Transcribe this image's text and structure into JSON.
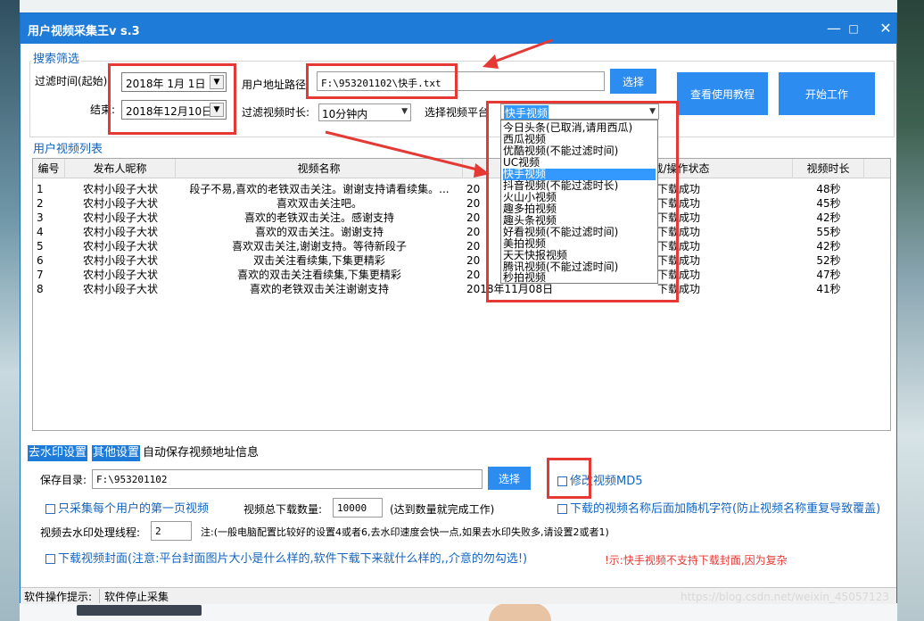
{
  "window": {
    "title": "用户视频采集王v s.3",
    "minimize_glyph": "—",
    "maximize_glyph": "□",
    "close_glyph": "✕"
  },
  "search": {
    "group_title": "搜索筛选",
    "start_label": "过滤时间(起始):",
    "start_date": "2018年 1月 1日",
    "end_label": "结束:",
    "end_date": "2018年12月10日",
    "path_label": "用户地址路径:",
    "path_value": "F:\\953201102\\快手.txt",
    "select_button": "选择",
    "duration_label": "过滤视频时长:",
    "duration_value": "10分钟内",
    "platform_label": "选择视频平台",
    "platform_value": "快手视频",
    "tutorial_button": "查看使用教程",
    "start_button": "开始工作"
  },
  "platform_options": [
    "今日头条(已取消,请用西瓜)",
    "西瓜视频",
    "优酷视频(不能过滤时间)",
    "UC视频",
    "快手视频",
    "抖音视频(不能过滤时长)",
    "火山小视频",
    "趣多拍视频",
    "趣头条视频",
    "好看视频(不能过滤时间)",
    "美拍视频",
    "天天快报视频",
    "腾讯视频(不能过滤时间)",
    "秒拍视频"
  ],
  "video_list": {
    "group_title": "用户视频列表",
    "columns": [
      "编号",
      "发布人昵称",
      "视频名称",
      "发",
      "载/操作状态",
      "视频时长"
    ],
    "rows": [
      {
        "id": "1",
        "user": "农村小段子大状",
        "name": "段子不易,喜欢的老铁双击关注。谢谢支持请看续集。...",
        "date": "20",
        "status": "下载成功",
        "duration": "48秒"
      },
      {
        "id": "2",
        "user": "农村小段子大状",
        "name": "喜欢双击关注吧。",
        "date": "20",
        "status": "下载成功",
        "duration": "45秒"
      },
      {
        "id": "3",
        "user": "农村小段子大状",
        "name": "喜欢的老铁双击关注。感谢支持",
        "date": "20",
        "status": "下载成功",
        "duration": "42秒"
      },
      {
        "id": "4",
        "user": "农村小段子大状",
        "name": "喜欢的双击关注。谢谢支持",
        "date": "20",
        "status": "下载成功",
        "duration": "55秒"
      },
      {
        "id": "5",
        "user": "农村小段子大状",
        "name": "喜欢双击关注,谢谢支持。等待新段子",
        "date": "20",
        "status": "下载成功",
        "duration": "42秒"
      },
      {
        "id": "6",
        "user": "农村小段子大状",
        "name": "双击关注看续集,下集更精彩",
        "date": "20",
        "status": "下载成功",
        "duration": "52秒"
      },
      {
        "id": "7",
        "user": "农村小段子大状",
        "name": "喜欢的双击关注看续集,下集更精彩",
        "date": "20",
        "status": "下载成功",
        "duration": "47秒"
      },
      {
        "id": "8",
        "user": "农村小段子大状",
        "name": "喜欢的老铁双击关注谢谢支持",
        "date": "2018年11月08日",
        "status": "下载成功",
        "duration": "41秒"
      }
    ]
  },
  "tabs": [
    "去水印设置",
    "其他设置",
    "自动保存视频地址信息"
  ],
  "settings": {
    "save_dir_label": "保存目录:",
    "save_dir_value": "F:\\953201102",
    "select_button": "选择",
    "modify_md5": "修改视频MD5",
    "first_page_only": "只采集每个用户的第一页视频",
    "total_label": "视频总下载数量:",
    "total_value": "10000",
    "total_note": "(达到数量就完成工作)",
    "random_name": "下载的视频名称后面加随机字符(防止视频名称重复导致覆盖)",
    "threads_label": "视频去水印处理线程:",
    "threads_value": "2",
    "threads_note": "注:(一般电脑配置比较好的设置4或者6,去水印速度会快一点,如果去水印失败多,请设置2或者1)",
    "download_cover": "下载视频封面(注意:平台封面图片大小是什么样的,软件下载下来就什么样的,,介意的勿勾选!)",
    "cover_notice": "!示:快手视频不支持下载封面,因为复杂"
  },
  "status": {
    "label": "软件操作提示:",
    "message": "软件停止采集",
    "watermark": "https://blog.csdn.net/weixin_45057123"
  }
}
